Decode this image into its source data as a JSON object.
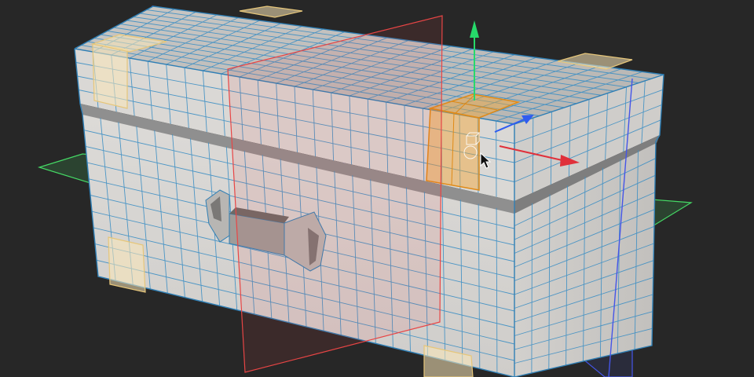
{
  "viewport": {
    "background": "#272727",
    "mesh": {
      "face_color": "#d9d7d4",
      "wire_color": "#3d8fc4",
      "groove_color": "#8f8f8f",
      "selection_color": "#f5a733"
    },
    "symmetry_planes": [
      {
        "name": "x-plane",
        "color": "#e84545"
      },
      {
        "name": "y-plane",
        "color": "#45d965"
      },
      {
        "name": "z-plane",
        "color": "#4555e8"
      }
    ],
    "gizmo": {
      "axes": [
        {
          "name": "y-axis",
          "color": "#26d96a"
        },
        {
          "name": "x-axis",
          "color": "#e0303a"
        },
        {
          "name": "z-axis",
          "color": "#2f5cf0"
        }
      ]
    },
    "cursor_icon": "arrow-cursor",
    "gizmo_icon": "object-pivot-icon"
  }
}
